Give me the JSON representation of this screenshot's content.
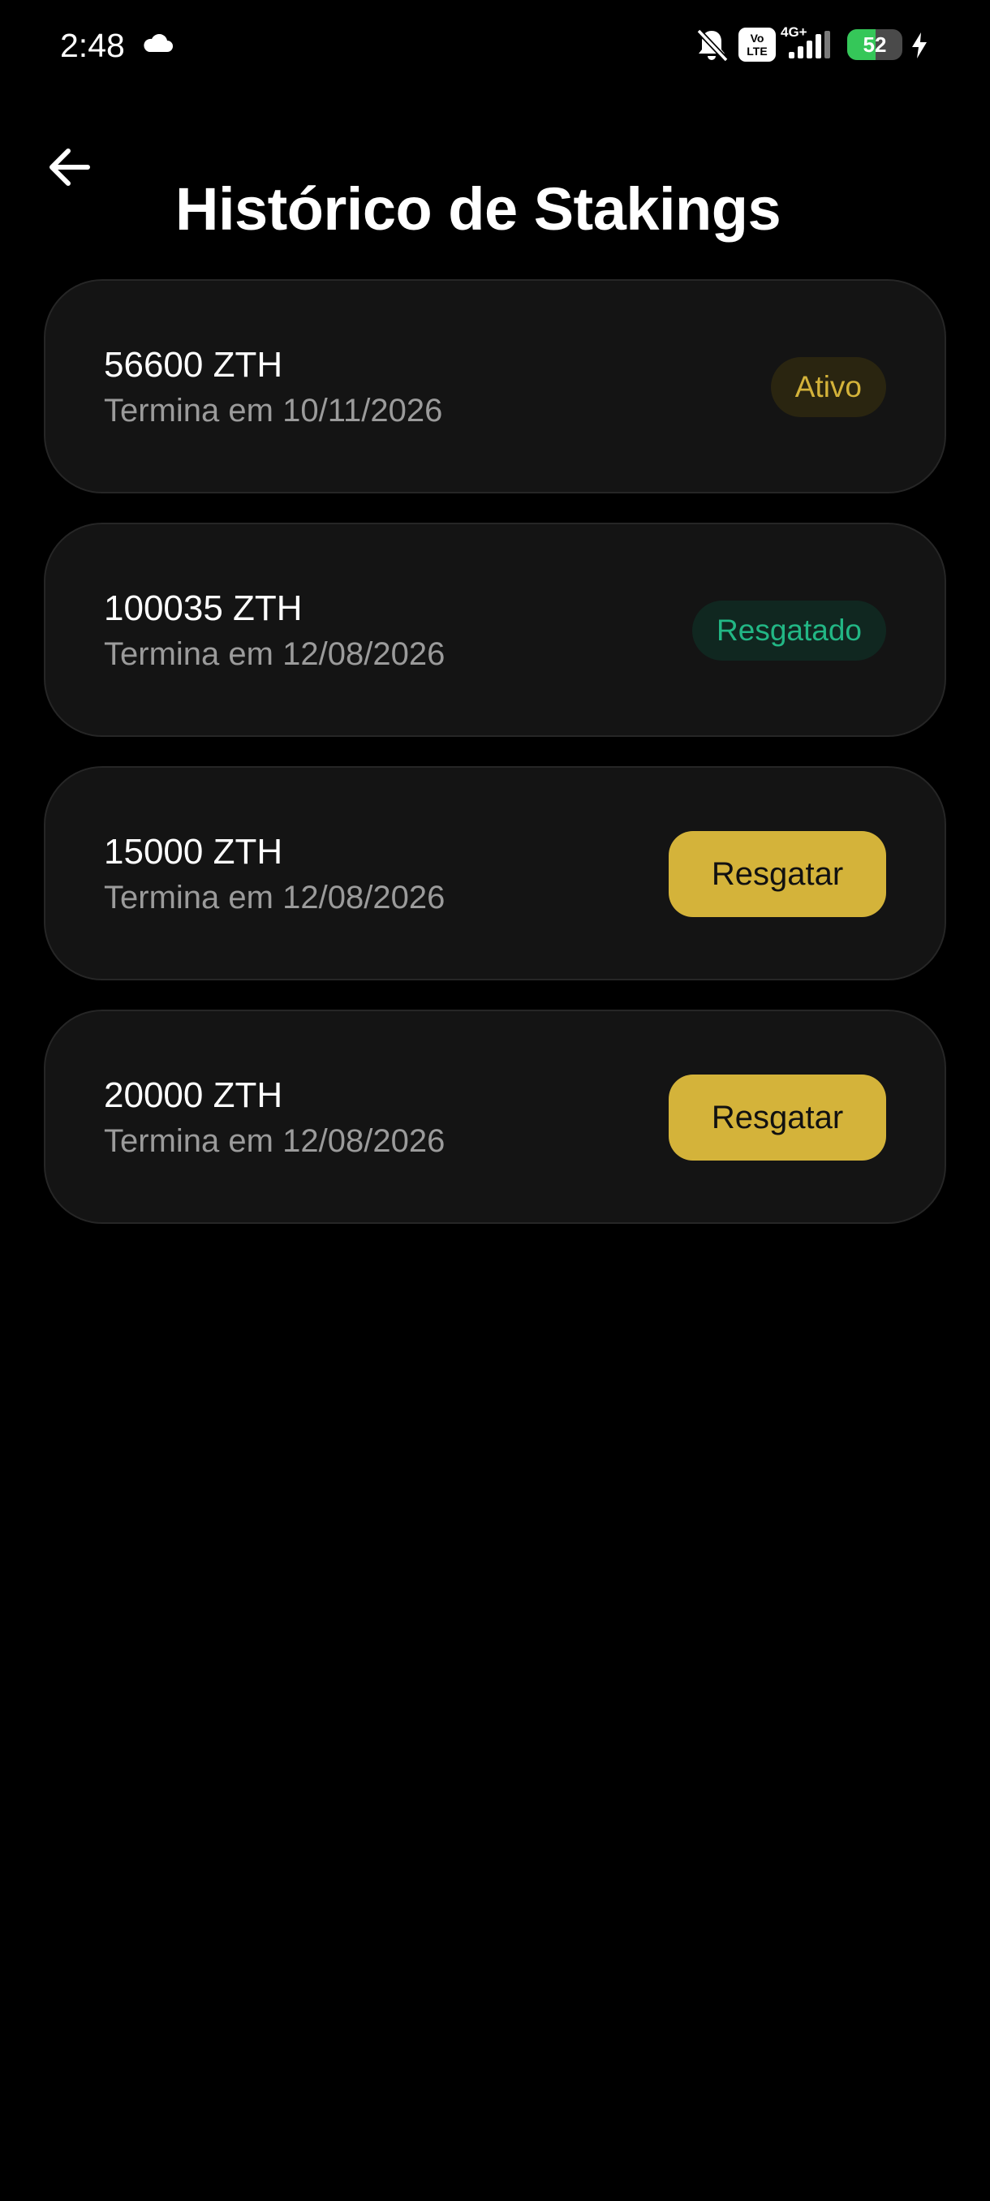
{
  "status_bar": {
    "time": "2:48",
    "network_type": "4G+",
    "volte_label": "Vo LTE",
    "battery_level": "52",
    "battery_fraction": 0.52,
    "icons": [
      "cloud-icon",
      "bell-off-icon",
      "volte-icon",
      "signal-icon",
      "battery-icon",
      "charging-icon"
    ]
  },
  "header": {
    "back_icon": "arrow-left-icon",
    "title": "Histórico de Stakings"
  },
  "labels": {
    "ends_prefix": "Termina em"
  },
  "stakings": [
    {
      "amount": "56600 ZTH",
      "end_date": "10/11/2026",
      "status": "Ativo",
      "action": ""
    },
    {
      "amount": "100035 ZTH",
      "end_date": "12/08/2026",
      "status": "Resgatado",
      "action": ""
    },
    {
      "amount": "15000 ZTH",
      "end_date": "12/08/2026",
      "status": "",
      "action": "Resgatar"
    },
    {
      "amount": "20000 ZTH",
      "end_date": "12/08/2026",
      "status": "",
      "action": "Resgatar"
    }
  ],
  "colors": {
    "background": "#000000",
    "card": "#141414",
    "accent_gold": "#d4b33a",
    "status_green": "#22b785",
    "muted_text": "#9b9b9b"
  }
}
